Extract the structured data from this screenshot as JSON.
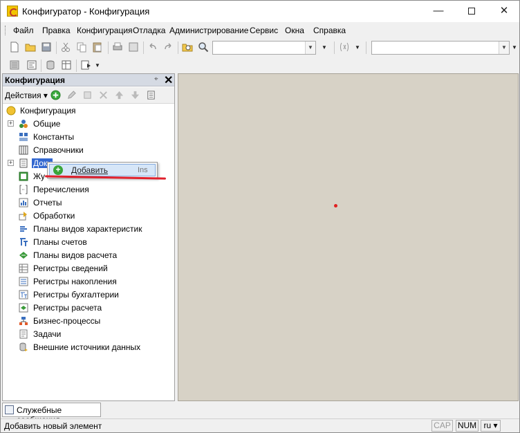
{
  "window": {
    "title": "Конфигуратор - Конфигурация"
  },
  "window_controls": {
    "minimize": "—",
    "close": "✕"
  },
  "menu": [
    "Файл",
    "Правка",
    "Конфигурация",
    "Отладка",
    "Администрирование",
    "Сервис",
    "Окна",
    "Справка"
  ],
  "toolbar": {
    "search_value": "",
    "second_combo_value": "",
    "dropdown_glyph": "▼"
  },
  "panel": {
    "title": "Конфигурация",
    "pin_glyph": "⌖",
    "close_glyph": "✕",
    "actions_label": "Действия",
    "actions_arrow": "▾"
  },
  "tree": {
    "root": "Конфигурация",
    "items": [
      "Общие",
      "Константы",
      "Справочники",
      "Документы",
      "Журналы документов",
      "Перечисления",
      "Отчеты",
      "Обработки",
      "Планы видов характеристик",
      "Планы счетов",
      "Планы видов расчета",
      "Регистры сведений",
      "Регистры накопления",
      "Регистры бухгалтерии",
      "Регистры расчета",
      "Бизнес-процессы",
      "Задачи",
      "Внешние источники данных"
    ],
    "visible_labels": {
      "documents_partial": "Доку",
      "journals_partial": "Жу"
    },
    "expander_glyph": "+"
  },
  "context_menu": {
    "item_label": "Добавить",
    "shortcut": "Ins"
  },
  "bottom": {
    "tab_label": "Служебные сообщения"
  },
  "status": {
    "text": "Добавить новый элемент",
    "cap": "CAP",
    "num": "NUM",
    "lang": "ru ▾"
  },
  "colors": {
    "selection": "#3368d0",
    "workspace": "#d7d2c6",
    "annotation": "#e0202c"
  }
}
